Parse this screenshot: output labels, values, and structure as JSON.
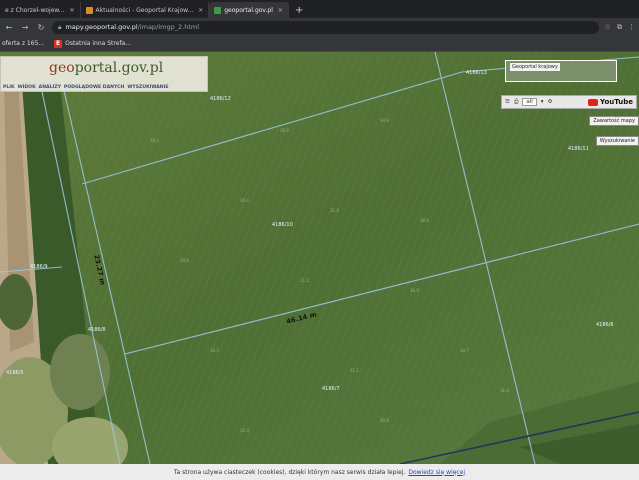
{
  "browser": {
    "tabs": [
      {
        "label": "e z Chorzel-wojew..."
      },
      {
        "label": "Aktualności - Geoportal Krajow..."
      },
      {
        "label": "geoportal.gov.pl"
      }
    ],
    "new_tab": "+",
    "address": {
      "host": "mapy.geoportal.gov.pl",
      "path": "/imap/Imgp_2.html"
    },
    "bookmarks": [
      {
        "label": "oferta z 165..."
      },
      {
        "label": "Ostatnia inna Strefa..."
      }
    ]
  },
  "geoportal": {
    "logo_a": "geo",
    "logo_b": "portal.gov.pl",
    "menu": [
      "PLIK",
      "WIDOK",
      "ANALIZY",
      "PODGLĄDOWE DANYCH",
      "WYSZUKIWANIE"
    ],
    "minimap_label": "Geoportal krajowy",
    "zoom_value": "all",
    "youtube_label": "YouTube",
    "side_buttons": [
      "Zawartość mapy",
      "Wyszukiwanie"
    ]
  },
  "map": {
    "parcels": [
      {
        "id": "4186/13"
      },
      {
        "id": "4186/12"
      },
      {
        "id": "4186/11"
      },
      {
        "id": "4186/10"
      },
      {
        "id": "4186/9"
      },
      {
        "id": "4186/8"
      },
      {
        "id": "4186/6"
      },
      {
        "id": "4186/7"
      },
      {
        "id": "4186/5"
      }
    ],
    "dimensions": {
      "horizontal": "46.14 m",
      "vertical": "23.27 m"
    }
  },
  "cookie_bar": {
    "text": "Ta strona używa ciasteczek (cookies), dzięki którym nasz serwis działa lepiej.",
    "link": "Dowiedz się więcej"
  }
}
